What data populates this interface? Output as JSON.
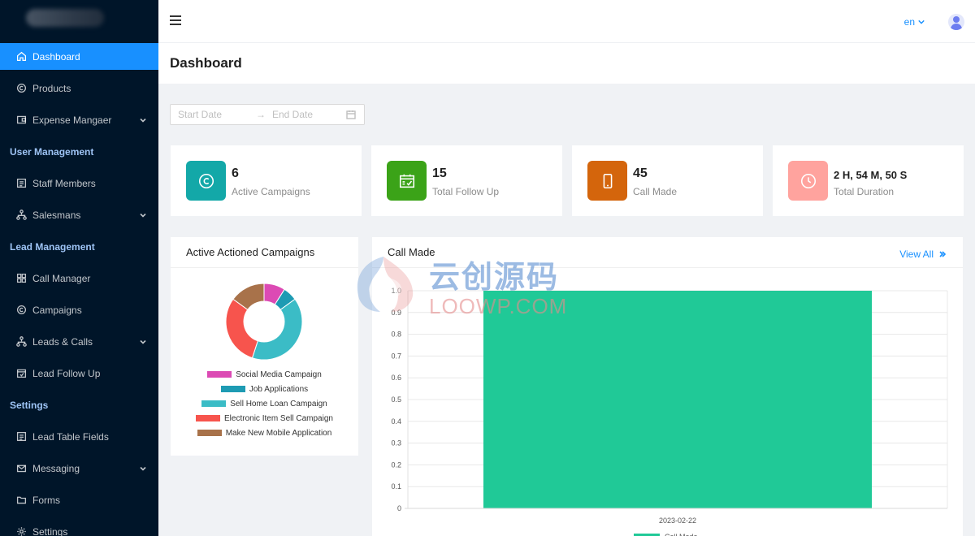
{
  "sidebar": {
    "items": [
      {
        "type": "item",
        "label": "Dashboard",
        "icon": "home-icon",
        "active": true,
        "expandable": false
      },
      {
        "type": "item",
        "label": "Products",
        "icon": "copyright-icon",
        "expandable": false
      },
      {
        "type": "item",
        "label": "Expense Mangaer",
        "icon": "wallet-icon",
        "expandable": true
      },
      {
        "type": "group",
        "label": "User Management"
      },
      {
        "type": "item",
        "label": "Staff Members",
        "icon": "id-card-icon",
        "expandable": false
      },
      {
        "type": "item",
        "label": "Salesmans",
        "icon": "cluster-icon",
        "expandable": true
      },
      {
        "type": "group",
        "label": "Lead Management"
      },
      {
        "type": "item",
        "label": "Call Manager",
        "icon": "grid-icon",
        "expandable": false
      },
      {
        "type": "item",
        "label": "Campaigns",
        "icon": "copyright-icon",
        "expandable": false
      },
      {
        "type": "item",
        "label": "Leads & Calls",
        "icon": "cluster-icon",
        "expandable": true
      },
      {
        "type": "item",
        "label": "Lead Follow Up",
        "icon": "calendar-check-icon",
        "expandable": false
      },
      {
        "type": "group",
        "label": "Settings"
      },
      {
        "type": "item",
        "label": "Lead Table Fields",
        "icon": "id-card-icon",
        "expandable": false
      },
      {
        "type": "item",
        "label": "Messaging",
        "icon": "mail-icon",
        "expandable": true
      },
      {
        "type": "item",
        "label": "Forms",
        "icon": "folder-icon",
        "expandable": false
      },
      {
        "type": "item",
        "label": "Settings",
        "icon": "gear-icon",
        "expandable": false
      }
    ]
  },
  "header": {
    "language": "en",
    "title": "Dashboard"
  },
  "date_range": {
    "start_placeholder": "Start Date",
    "end_placeholder": "End Date",
    "separator": "→"
  },
  "stats": [
    {
      "value": "6",
      "label": "Active Campaigns",
      "color": "#13a8a8",
      "icon": "copyright-icon"
    },
    {
      "value": "15",
      "label": "Total Follow Up",
      "color": "#3ba318",
      "icon": "calendar-check-icon"
    },
    {
      "value": "45",
      "label": "Call Made",
      "color": "#d4650c",
      "icon": "mobile-icon"
    },
    {
      "value": "2 H, 54 M, 50 S",
      "label": "Total Duration",
      "color": "#ffa39e",
      "icon": "clock-icon"
    }
  ],
  "campaign_panel": {
    "title": "Active Actioned Campaigns"
  },
  "call_panel": {
    "title": "Call Made",
    "view_all": "View All"
  },
  "watermark": {
    "cn": "云创源码",
    "en": "LOOWP.COM"
  },
  "chart_data": [
    {
      "type": "pie",
      "title": "Active Actioned Campaigns",
      "donut": true,
      "legend_position": "bottom",
      "slices": [
        {
          "name": "Social Media Campaign",
          "value": 9,
          "color": "#dc4ab4"
        },
        {
          "name": "Job Applications",
          "value": 6,
          "color": "#1e9bb3"
        },
        {
          "name": "Sell Home Loan Campaign",
          "value": 40,
          "color": "#3bbcc6"
        },
        {
          "name": "Electronic Item Sell Campaign",
          "value": 30,
          "color": "#f7544d"
        },
        {
          "name": "Make New Mobile Application",
          "value": 15,
          "color": "#a8724a"
        }
      ]
    },
    {
      "type": "bar",
      "title": "Call Made",
      "categories": [
        "2023-02-22"
      ],
      "series": [
        {
          "name": "Call Made",
          "values": [
            1.0
          ],
          "color": "#20c997"
        }
      ],
      "ylim": [
        0,
        1.0
      ],
      "yticks": [
        "0",
        "0.1",
        "0.2",
        "0.3",
        "0.4",
        "0.5",
        "0.6",
        "0.7",
        "0.8",
        "0.9",
        "1.0"
      ],
      "grid": true,
      "legend_position": "bottom"
    }
  ]
}
